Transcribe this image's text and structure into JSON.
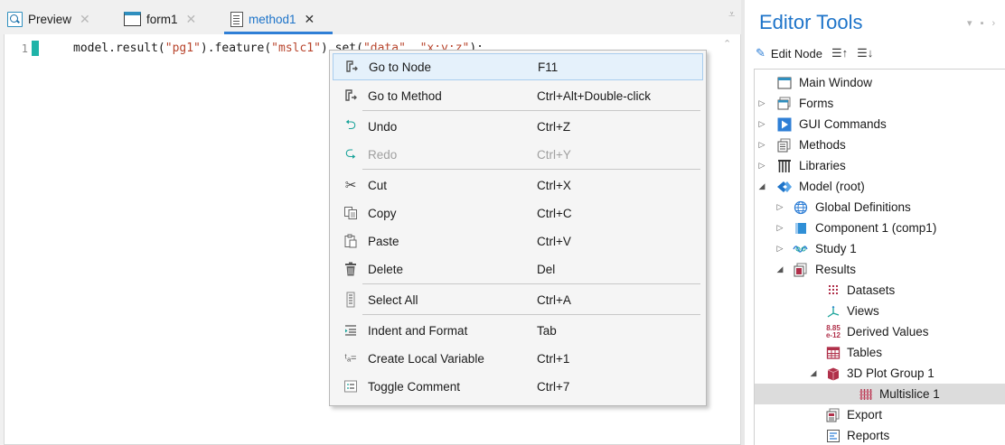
{
  "tabs": [
    {
      "label": "Preview",
      "icon": "magnifier-preview-icon",
      "active": false
    },
    {
      "label": "form1",
      "icon": "form-icon",
      "active": false
    },
    {
      "label": "method1",
      "icon": "method-icon",
      "active": true
    }
  ],
  "tab_close_glyph": "✕",
  "editor": {
    "line_number": "1",
    "code_parts": [
      "model.result(",
      "\"pg1\"",
      ").feature(",
      "\"mslc1\"",
      ").set(",
      "\"data\"",
      ", ",
      "\"x;y;z\"",
      ");"
    ]
  },
  "context_menu": {
    "items": [
      {
        "label": "Go to Node",
        "shortcut": "F11",
        "icon": "goto-node-icon",
        "enabled": true,
        "highlighted": true
      },
      {
        "label": "Go to Method",
        "shortcut": "Ctrl+Alt+Double-click",
        "icon": "goto-method-icon",
        "enabled": true
      },
      {
        "label": "Undo",
        "shortcut": "Ctrl+Z",
        "icon": "undo-icon",
        "enabled": true
      },
      {
        "label": "Redo",
        "shortcut": "Ctrl+Y",
        "icon": "redo-icon",
        "enabled": false
      },
      {
        "label": "Cut",
        "shortcut": "Ctrl+X",
        "icon": "scissors-icon",
        "enabled": true
      },
      {
        "label": "Copy",
        "shortcut": "Ctrl+C",
        "icon": "copy-icon",
        "enabled": true
      },
      {
        "label": "Paste",
        "shortcut": "Ctrl+V",
        "icon": "paste-icon",
        "enabled": true
      },
      {
        "label": "Delete",
        "shortcut": "Del",
        "icon": "trash-icon",
        "enabled": true
      },
      {
        "label": "Select All",
        "shortcut": "Ctrl+A",
        "icon": "select-all-icon",
        "enabled": true
      },
      {
        "label": "Indent and Format",
        "shortcut": "Tab",
        "icon": "indent-icon",
        "enabled": true
      },
      {
        "label": "Create Local Variable",
        "shortcut": "Ctrl+1",
        "icon": "local-variable-icon",
        "enabled": true
      },
      {
        "label": "Toggle Comment",
        "shortcut": "Ctrl+7",
        "icon": "comment-icon",
        "enabled": true
      }
    ]
  },
  "editor_tools": {
    "title": "Editor Tools",
    "edit_node_label": "Edit Node",
    "tree": [
      {
        "label": "Main Window",
        "icon": "window-icon",
        "expander": ""
      },
      {
        "label": "Forms",
        "icon": "forms-icon",
        "expander": "collapsed"
      },
      {
        "label": "GUI Commands",
        "icon": "gui-commands-icon",
        "expander": "collapsed"
      },
      {
        "label": "Methods",
        "icon": "methods-icon",
        "expander": "collapsed"
      },
      {
        "label": "Libraries",
        "icon": "libraries-icon",
        "expander": "collapsed"
      },
      {
        "label": "Model (root)",
        "icon": "model-root-icon",
        "expander": "expanded"
      },
      {
        "label": "Global Definitions",
        "icon": "globe-icon",
        "expander": "collapsed"
      },
      {
        "label": "Component 1 (comp1)",
        "icon": "component-icon",
        "expander": "collapsed"
      },
      {
        "label": "Study 1",
        "icon": "study-icon",
        "expander": "collapsed"
      },
      {
        "label": "Results",
        "icon": "results-icon",
        "expander": "expanded"
      },
      {
        "label": "Datasets",
        "icon": "datasets-icon",
        "expander": ""
      },
      {
        "label": "Views",
        "icon": "views-icon",
        "expander": ""
      },
      {
        "label": "Derived Values",
        "icon": "derived-values-icon",
        "expander": ""
      },
      {
        "label": "Tables",
        "icon": "tables-icon",
        "expander": ""
      },
      {
        "label": "3D Plot Group 1",
        "icon": "plot-group-icon",
        "expander": "expanded"
      },
      {
        "label": "Multislice 1",
        "icon": "multislice-icon",
        "expander": "",
        "selected": true
      },
      {
        "label": "Export",
        "icon": "export-icon",
        "expander": ""
      },
      {
        "label": "Reports",
        "icon": "reports-icon",
        "expander": ""
      }
    ]
  },
  "colors": {
    "accent": "#1e74c9",
    "code_string": "#b8452d",
    "line_marker": "#1fb3a8"
  }
}
